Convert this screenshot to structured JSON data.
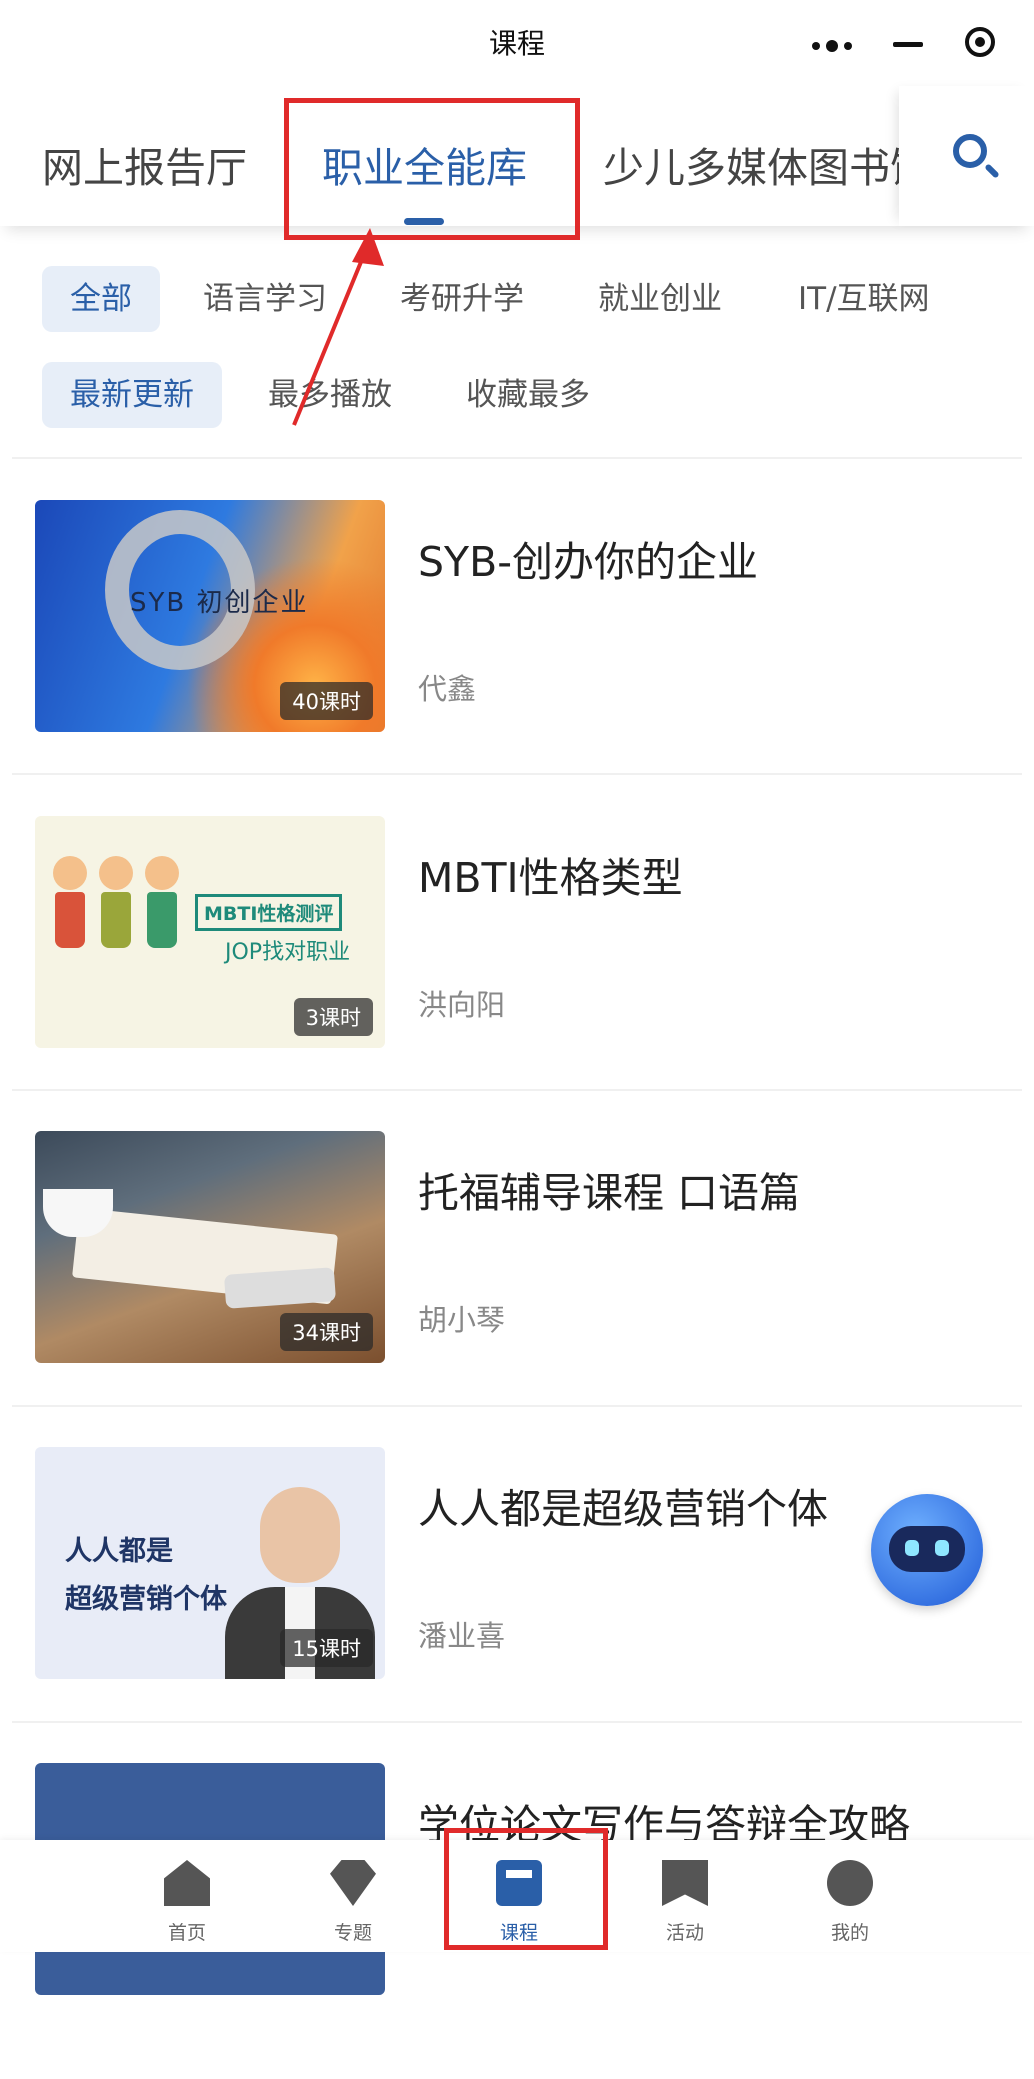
{
  "window": {
    "title": "课程"
  },
  "library_tabs": [
    {
      "label": "网上报告厅"
    },
    {
      "label": "职业全能库"
    },
    {
      "label": "少儿多媒体图书馆"
    }
  ],
  "category_chips": [
    {
      "label": "全部"
    },
    {
      "label": "语言学习"
    },
    {
      "label": "考研升学"
    },
    {
      "label": "就业创业"
    },
    {
      "label": "IT/互联网"
    }
  ],
  "sort_chips": [
    {
      "label": "最新更新"
    },
    {
      "label": "最多播放"
    },
    {
      "label": "收藏最多"
    }
  ],
  "courses": [
    {
      "title": "SYB-创办你的企业",
      "author": "代鑫",
      "lessons": "40课时",
      "thumb_text": "SYB 初创企业"
    },
    {
      "title": "MBTI性格类型",
      "author": "洪向阳",
      "lessons": "3课时",
      "thumb_text": "MBTI性格测评",
      "thumb_text2": "JOP找对职业"
    },
    {
      "title": "托福辅导课程 口语篇",
      "author": "胡小琴",
      "lessons": "34课时"
    },
    {
      "title": "人人都是超级营销个体",
      "author": "潘业喜",
      "lessons": "15课时",
      "thumb_text": "人人都是",
      "thumb_text2": "超级营销个体"
    },
    {
      "title": "学位论文写作与答辩全攻略"
    }
  ],
  "bottom_nav": [
    {
      "label": "首页",
      "icon": "home-icon"
    },
    {
      "label": "专题",
      "icon": "topic-icon"
    },
    {
      "label": "课程",
      "icon": "course-icon"
    },
    {
      "label": "活动",
      "icon": "activity-icon"
    },
    {
      "label": "我的",
      "icon": "profile-icon"
    }
  ],
  "colors": {
    "accent": "#2a5fa8",
    "annotation": "#e02a2a",
    "chip_bg": "#e7eef8"
  }
}
